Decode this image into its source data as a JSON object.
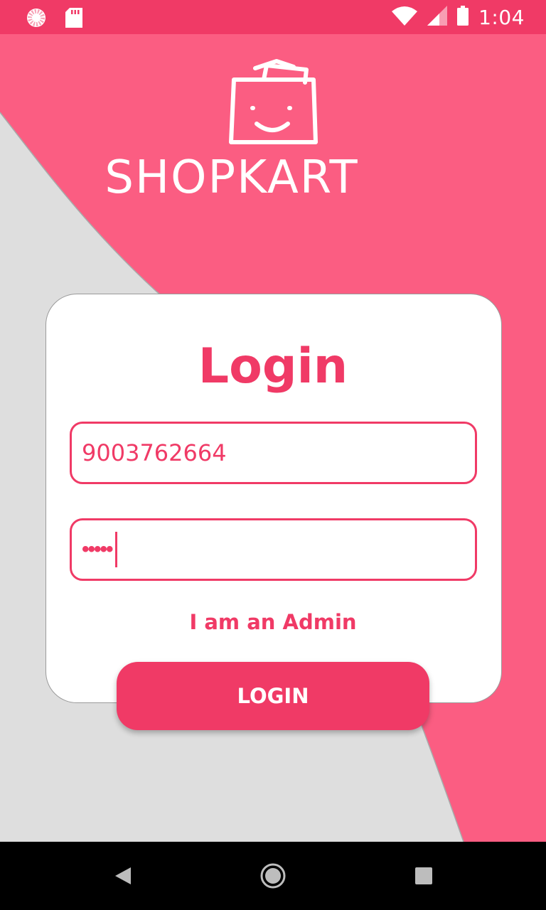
{
  "status_bar": {
    "time": "1:04",
    "left_icons": [
      "sync-icon",
      "sd-card-icon"
    ],
    "right_icons": [
      "wifi-icon",
      "signal-icon",
      "battery-icon"
    ]
  },
  "app": {
    "brand": "SHOPKART",
    "brand_icon": "shopping-bag-smile-icon",
    "accent_color": "#f03a66",
    "header_color": "#fb5d82",
    "background_color": "#dedede"
  },
  "login_card": {
    "title": "Login",
    "phone_field": {
      "value": "9003762664"
    },
    "password_field": {
      "value": "•••••"
    },
    "admin_link": "I am an Admin",
    "login_button": "LOGIN"
  },
  "nav_bar": {
    "buttons": [
      "back-icon",
      "home-icon",
      "recents-icon"
    ]
  }
}
